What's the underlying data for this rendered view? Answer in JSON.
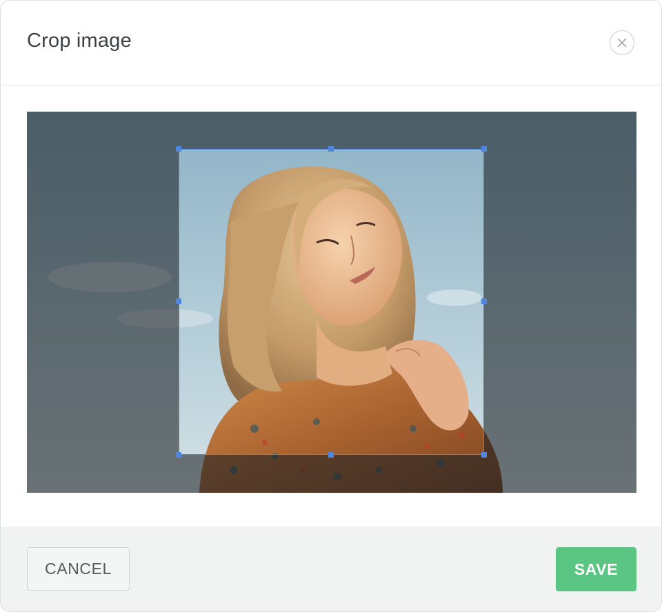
{
  "dialog": {
    "title": "Crop image",
    "close_icon": "close-icon"
  },
  "image": {
    "subject": "portrait photo",
    "colors": {
      "sky_top": "#8fb3c6",
      "sky_bottom": "#c9d9e0",
      "hair": "#c8a273",
      "skin": "#e9bf98",
      "shirt": "#b8703a"
    }
  },
  "crop": {
    "selection_color": "#4f86e0"
  },
  "footer": {
    "cancel_label": "CANCEL",
    "save_label": "SAVE",
    "save_color": "#5bc583"
  }
}
